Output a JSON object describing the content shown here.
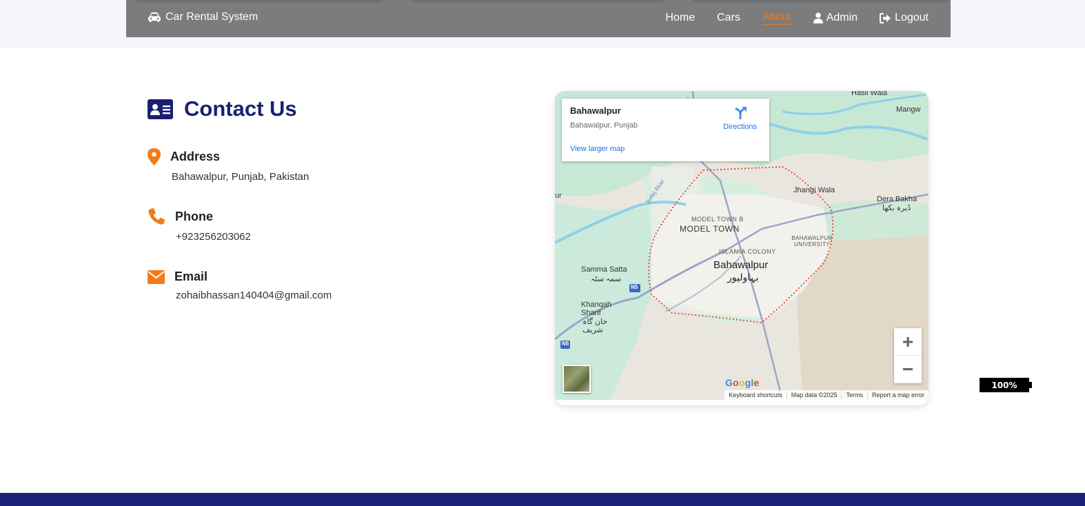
{
  "navbar": {
    "brand": "Car Rental System",
    "links": [
      {
        "label": "Home",
        "active": false
      },
      {
        "label": "Cars",
        "active": false
      },
      {
        "label": "About",
        "active": true
      },
      {
        "label": "Admin",
        "active": false,
        "icon": "user-icon"
      },
      {
        "label": "Logout",
        "active": false,
        "icon": "logout-icon"
      }
    ],
    "brand_icon": "car-icon"
  },
  "contact": {
    "title": "Contact Us",
    "title_icon": "id-card-icon",
    "address": {
      "label": "Address",
      "value": "Bahawalpur, Punjab, Pakistan",
      "icon": "map-marker-icon"
    },
    "phone": {
      "label": "Phone",
      "value": "+923256203062",
      "icon": "phone-icon"
    },
    "email": {
      "label": "Email",
      "value": "zohaibhassan140404@gmail.com",
      "icon": "envelope-icon"
    }
  },
  "map": {
    "place_name": "Bahawalpur",
    "place_sub": "Bahawalpur, Punjab",
    "directions_label": "Directions",
    "larger_map_label": "View larger map",
    "zoom_in": "+",
    "zoom_out": "−",
    "attribution": [
      "Keyboard shortcuts",
      "Map data ©2025",
      "Terms",
      "Report a map error"
    ],
    "labels": {
      "hasil_wala": "Hasil Wala",
      "mangw": "Mangw",
      "jhangi_wala": "Jhangi Wala",
      "dera_bakha": "Dera Bakha",
      "dera_bakha_ur": "ڈیرہ بکھا",
      "model_town_b": "MODEL TOWN B",
      "model_town": "MODEL TOWN",
      "bahawalpur_university": "BAHAWALPUR UNIVERSITY",
      "islamia_colony": "ISLAMIA COLONY",
      "bahawalpur": "Bahawalpur",
      "bahawalpur_ur": "بہاولپور",
      "samma_satta": "Samma Satta",
      "samma_satta_ur": "سمہ سٹہ",
      "khanqah_sharif": "Khanqah Sharif",
      "khanqah_sharif_ur": "خان گاہ شریف",
      "sutlej_river": "Sutlej River",
      "n5": "N5",
      "ur": "ur",
      "google": "Google"
    }
  },
  "battery": "100%",
  "colors": {
    "accent": "#f07b1a",
    "navy": "#1a2172",
    "navbar": "#7b7c7e",
    "footer": "#1b2077"
  }
}
